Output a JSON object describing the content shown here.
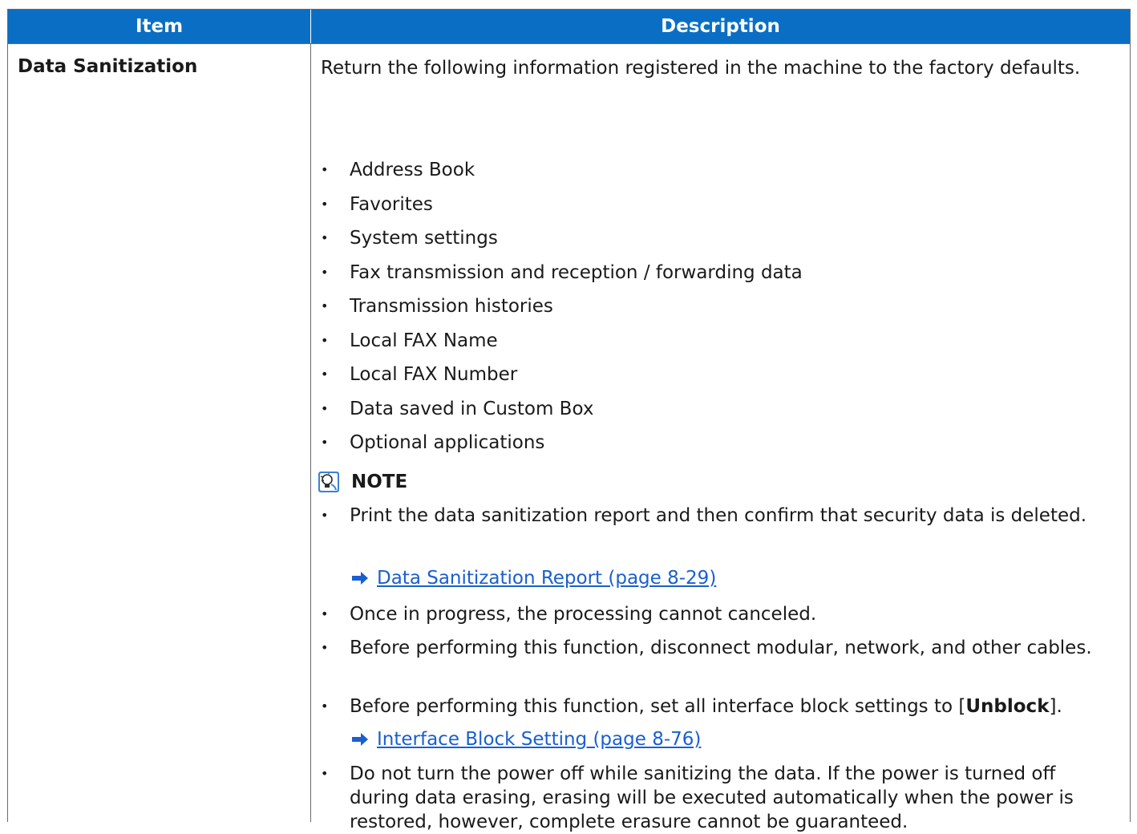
{
  "header": {
    "col_item": "Item",
    "col_description": "Description"
  },
  "row": {
    "item": "Data Sanitization",
    "intro": "Return the following information registered in the machine to the factory defaults.",
    "list": [
      "Address Book",
      "Favorites",
      "System settings",
      "Fax transmission and reception / forwarding data",
      "Transmission histories",
      "Local FAX Name",
      "Local FAX Number",
      "Data saved in Custom Box",
      "Optional applications"
    ],
    "note_label": "NOTE",
    "notes": [
      "Print the data sanitization report and then confirm that security data is deleted.",
      "Once in progress, the processing cannot canceled.",
      "Before performing this function, disconnect modular, network, and other cables.",
      "Before performing this function, set all interface block settings to [",
      "Do not turn the power off while sanitizing the data. If the power is turned off during data erasing, erasing will be executed automatically when the power is restored, however, complete erasure cannot be guaranteed."
    ],
    "note4_bold": "Unblock",
    "note4_end": "].",
    "link1": "Data Sanitization Report (page 8-29)",
    "link2": "Interface Block Setting (page 8-76)"
  },
  "colors": {
    "header_bg": "#0a6fc4",
    "link": "#1a5fd0"
  }
}
